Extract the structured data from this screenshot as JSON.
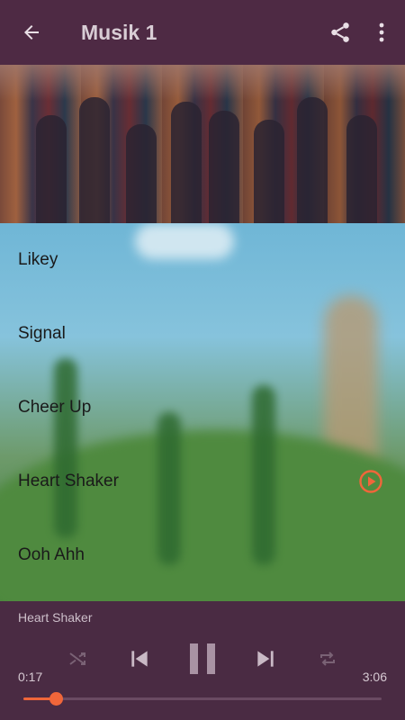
{
  "appbar": {
    "title": "Musik 1",
    "back_icon": "arrow-left-icon",
    "share_icon": "share-icon",
    "more_icon": "more-vertical-icon",
    "background": "#4e2a44"
  },
  "tracks": [
    {
      "name": "Likey",
      "playing": false
    },
    {
      "name": "Signal",
      "playing": false
    },
    {
      "name": "Cheer Up",
      "playing": false
    },
    {
      "name": "Heart Shaker",
      "playing": true
    },
    {
      "name": "Ooh Ahh",
      "playing": false
    }
  ],
  "player": {
    "now_playing": "Heart Shaker",
    "elapsed": "0:17",
    "total": "3:06",
    "progress": 0.09,
    "is_paused": false,
    "accent": "#f0663a",
    "icons": [
      "shuffle-icon",
      "previous-icon",
      "pause-icon",
      "next-icon",
      "repeat-icon"
    ]
  }
}
